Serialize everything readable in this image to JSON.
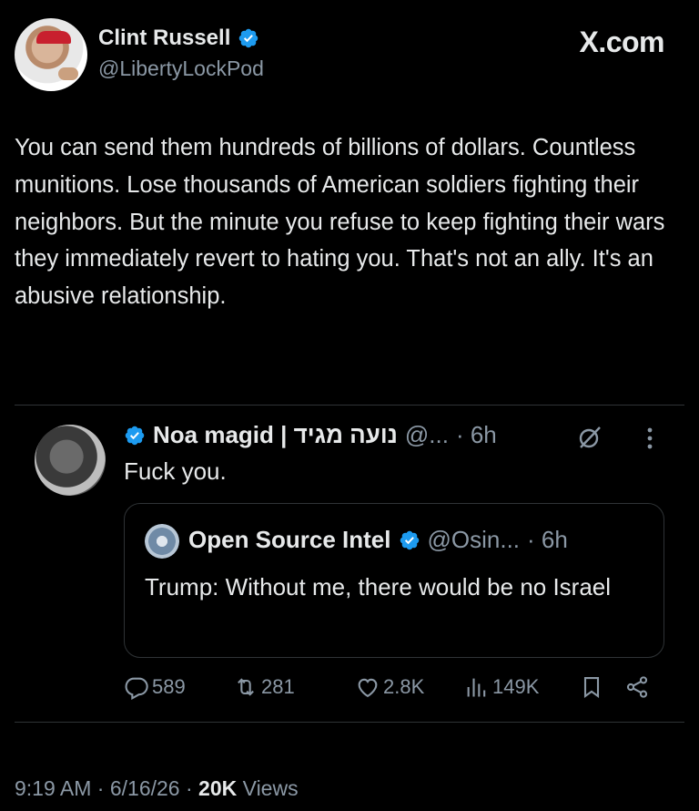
{
  "author": {
    "name": "Clint Russell",
    "handle": "@LibertyLockPod",
    "verified": true
  },
  "brand": "X.com",
  "tweet": {
    "text": "You can send them hundreds of billions of dollars. Countless munitions. Lose thousands of American soldiers fighting their neighbors. But the minute you refuse to keep fighting their wars they immediately revert to hating you. That's not an ally. It's an abusive relationship."
  },
  "reply": {
    "name": "Noa magid | נועה מגיד",
    "handle": "@...",
    "time": "· 6h",
    "text": "Fuck you.",
    "quote": {
      "name": "Open Source Intel",
      "handle": "@Osin...",
      "time": "· 6h",
      "text": "Trump: Without me, there would be no Israel"
    },
    "stats": {
      "replies": "589",
      "retweets": "281",
      "likes": "2.8K",
      "views": "149K"
    }
  },
  "footer": {
    "time": "9:19 AM",
    "sep1": "·",
    "date": "6/16/26",
    "sep2": "·",
    "views_count": "20K",
    "views_label": "Views"
  },
  "colors": {
    "background": "#000000",
    "text": "#e7e9ea",
    "muted": "#8b98a5",
    "verified_blue": "#1d9bf0",
    "border": "#2f3336"
  },
  "icons": [
    "verified-badge-icon",
    "grok-icon",
    "more-icon",
    "reply-icon",
    "retweet-icon",
    "like-icon",
    "views-icon",
    "bookmark-icon",
    "share-icon"
  ]
}
